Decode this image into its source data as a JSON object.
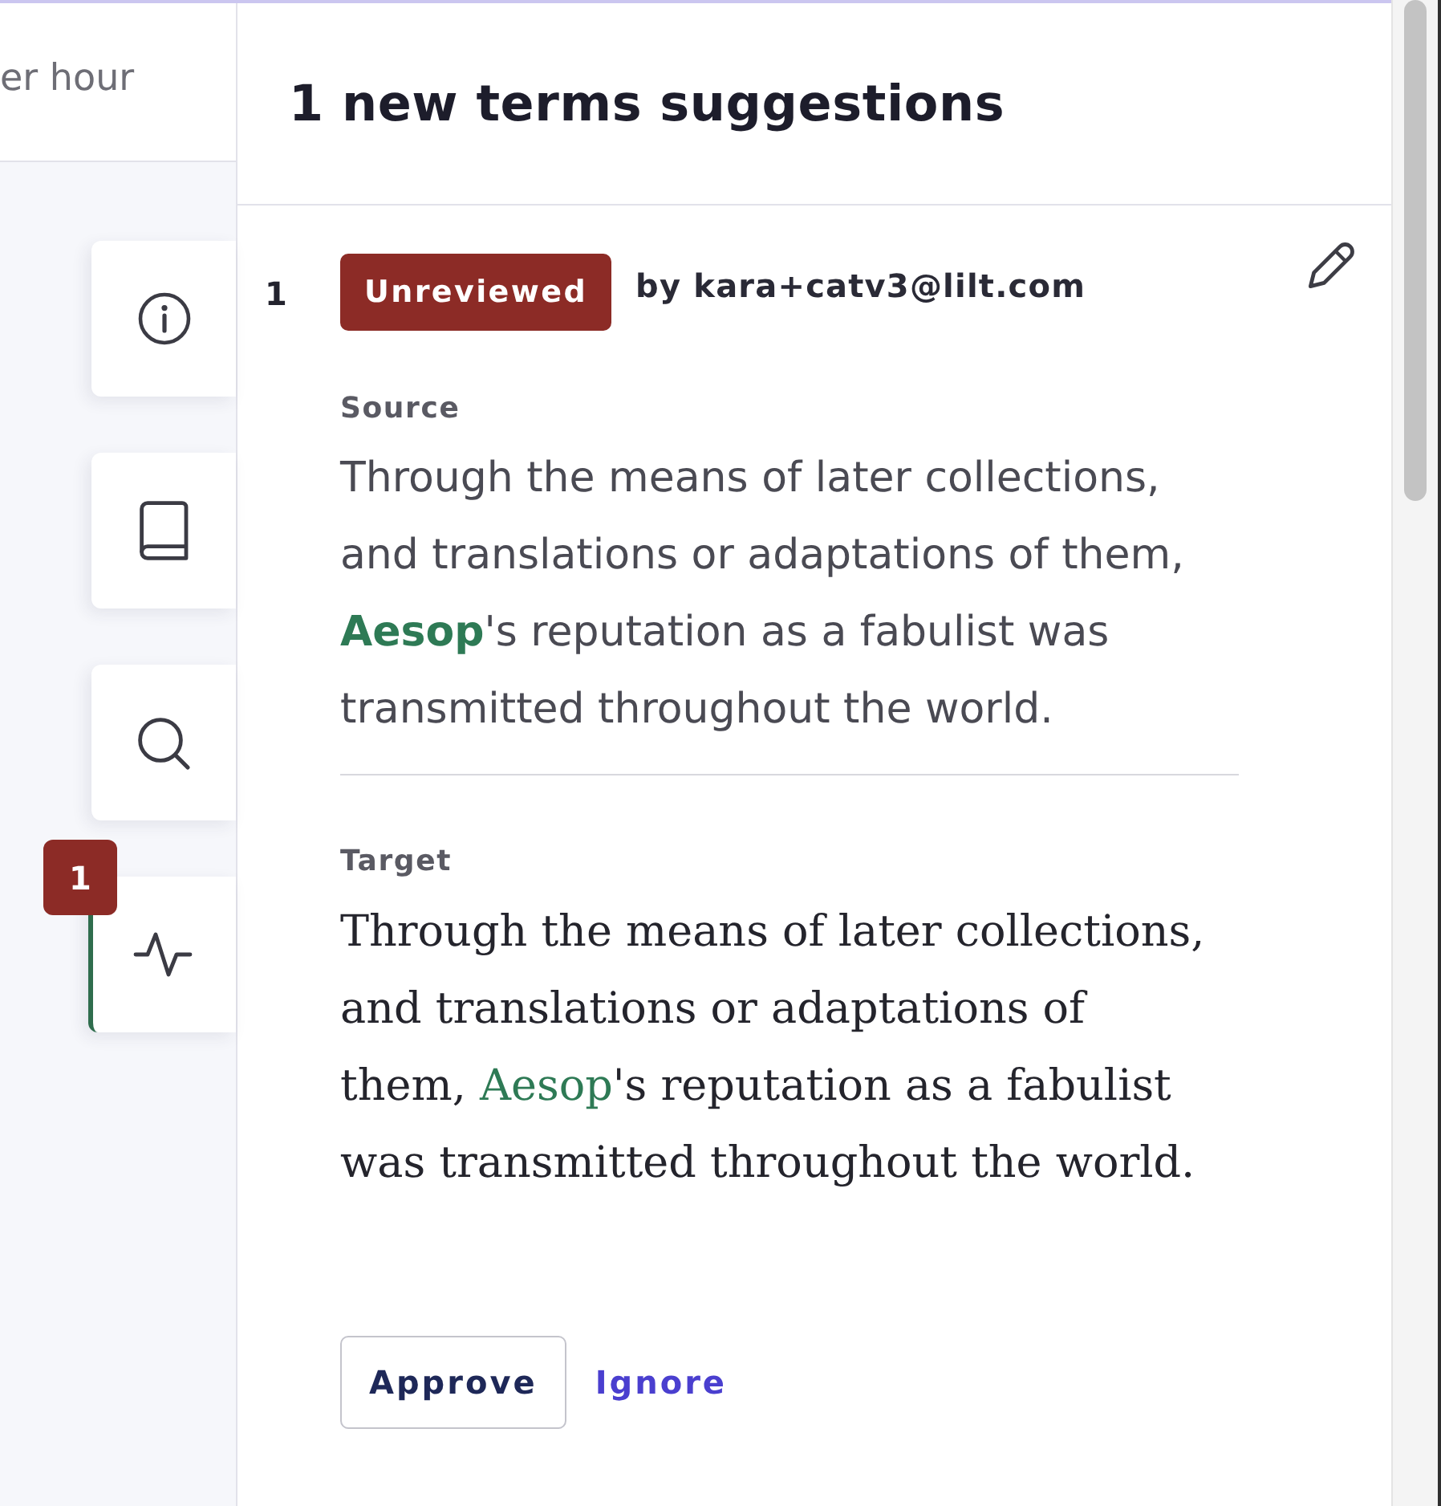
{
  "left_panel": {
    "header_text": "er hour",
    "side_tabs": [
      {
        "kind": "info",
        "selected": false
      },
      {
        "kind": "book",
        "selected": false
      },
      {
        "kind": "search",
        "selected": false
      },
      {
        "kind": "activity",
        "selected": true,
        "badge": "1"
      }
    ]
  },
  "suggestions_panel": {
    "title": "1 new terms suggestions",
    "suggestions": [
      {
        "number": "1",
        "status": "Unreviewed",
        "author": "by kara+catv3@lilt.com",
        "source": {
          "label": "Source",
          "segments": [
            {
              "text": "Through the means of later collections, and translations or adaptations of them, ",
              "term": false
            },
            {
              "text": "Aesop",
              "term": true
            },
            {
              "text": "'s reputation as a fabulist was transmitted throughout the world.",
              "term": false
            }
          ]
        },
        "target": {
          "label": "Target",
          "segments": [
            {
              "text": "Through the means of later collections, and translations or adaptations of them, ",
              "term": false
            },
            {
              "text": "Aesop",
              "term": true
            },
            {
              "text": "'s reputation as a fabulist was transmitted throughout the world.",
              "term": false
            }
          ]
        },
        "actions": [
          {
            "kind": "button",
            "label": "Approve"
          },
          {
            "kind": "link",
            "label": "Ignore"
          }
        ]
      }
    ]
  }
}
